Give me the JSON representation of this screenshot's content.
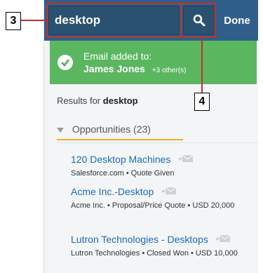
{
  "search": {
    "value": "desktop",
    "done_label": "Done"
  },
  "toast": {
    "line1": "Email added to:",
    "name": "James Jones",
    "extra": "+3 other(s)"
  },
  "results": {
    "prefix": "Results for",
    "query": "desktop"
  },
  "section": {
    "label": "Opportunities (23)"
  },
  "items": [
    {
      "title": "120 Desktop Machines",
      "meta": "Salesforce.com • Quote Given"
    },
    {
      "title": "Acme Inc.-Desktop",
      "meta": "Acme Inc. • Proposal/Price Quote • USD 20,000"
    },
    {
      "title": "Lutron Technologies - Desktops",
      "meta": "Lutron Technologies • Closed Won • USD 10,000"
    }
  ],
  "callouts": {
    "search_field": "3",
    "search_button": "4"
  }
}
